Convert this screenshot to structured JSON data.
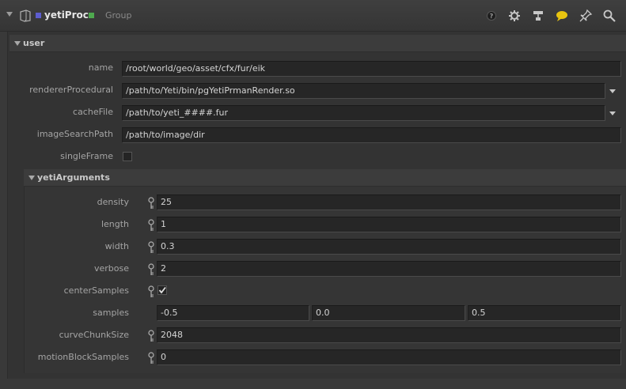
{
  "header": {
    "node_name": "yetiProc",
    "node_type": "Group",
    "colors": {
      "bg": "#393939",
      "swatch_blue": "#5d5dcf",
      "swatch_green": "#4ea94e",
      "comment_icon": "#e8c410"
    },
    "icons": [
      "help-icon",
      "gear-icon",
      "network-icon",
      "comment-icon",
      "pin-icon",
      "search-icon"
    ]
  },
  "user": {
    "title": "user",
    "params": {
      "name": {
        "label": "name",
        "value": "/root/world/geo/asset/cfx/fur/eik"
      },
      "rendererProcedural": {
        "label": "rendererProcedural",
        "value": "/path/to/Yeti/bin/pgYetiPrmanRender.so"
      },
      "cacheFile": {
        "label": "cacheFile",
        "value": "/path/to/yeti_####.fur"
      },
      "imageSearchPath": {
        "label": "imageSearchPath",
        "value": "/path/to/image/dir"
      },
      "singleFrame": {
        "label": "singleFrame",
        "checked": false
      }
    }
  },
  "yetiArguments": {
    "title": "yetiArguments",
    "params": {
      "density": {
        "label": "density",
        "value": "25"
      },
      "length": {
        "label": "length",
        "value": "1"
      },
      "width": {
        "label": "width",
        "value": "0.3"
      },
      "verbose": {
        "label": "verbose",
        "value": "2"
      },
      "centerSamples": {
        "label": "centerSamples",
        "checked": true
      },
      "samples": {
        "label": "samples",
        "values": [
          "-0.5",
          "0.0",
          "0.5"
        ]
      },
      "curveChunkSize": {
        "label": "curveChunkSize",
        "value": "2048"
      },
      "motionBlockSamples": {
        "label": "motionBlockSamples",
        "value": "0"
      }
    }
  }
}
